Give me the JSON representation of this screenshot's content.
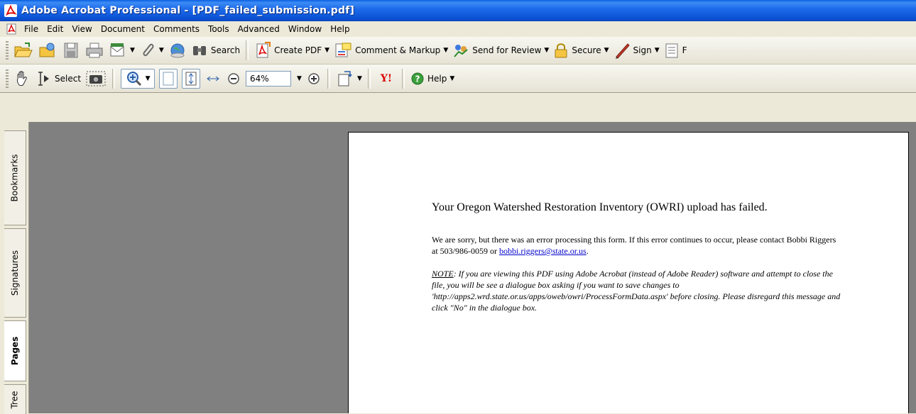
{
  "window": {
    "title": "Adobe Acrobat Professional - [PDF_failed_submission.pdf]"
  },
  "menu": {
    "items": [
      "File",
      "Edit",
      "View",
      "Document",
      "Comments",
      "Tools",
      "Advanced",
      "Window",
      "Help"
    ]
  },
  "toolbar1": {
    "search_label": "Search",
    "create_pdf_label": "Create PDF",
    "comment_label": "Comment & Markup",
    "review_label": "Send for Review",
    "secure_label": "Secure",
    "sign_label": "Sign",
    "forms_label": "F"
  },
  "toolbar2": {
    "select_label": "Select",
    "zoom_value": "64%",
    "help_label": "Help",
    "yahoo_label": "Y!"
  },
  "nav_tabs": [
    "Bookmarks",
    "Signatures",
    "Pages",
    "Tree"
  ],
  "document": {
    "heading": "Your Oregon Watershed Restoration Inventory (OWRI) upload has failed.",
    "para_text": "We are sorry, but there was an error processing this form.  If this error continues to occur, please contact Bobbi Riggers at 503/986-0059 or ",
    "email": "bobbi.riggers@state.or.us",
    "para_end": ".",
    "note_label": "NOTE",
    "note_text": ":  If you are viewing this PDF using Adobe Acrobat (instead of Adobe Reader) software and attempt to close the file, you will be see a dialogue box asking if you want to save changes to 'http://apps2.wrd.state.or.us/apps/oweb/owri/ProcessFormData.aspx' before closing.  Please disregard this message and click \"No\" in the dialogue box."
  },
  "colors": {
    "titlebar": "#0A5FE0",
    "chrome": "#ECE9D8",
    "viewer_bg": "#808080",
    "link": "#0000CC"
  }
}
